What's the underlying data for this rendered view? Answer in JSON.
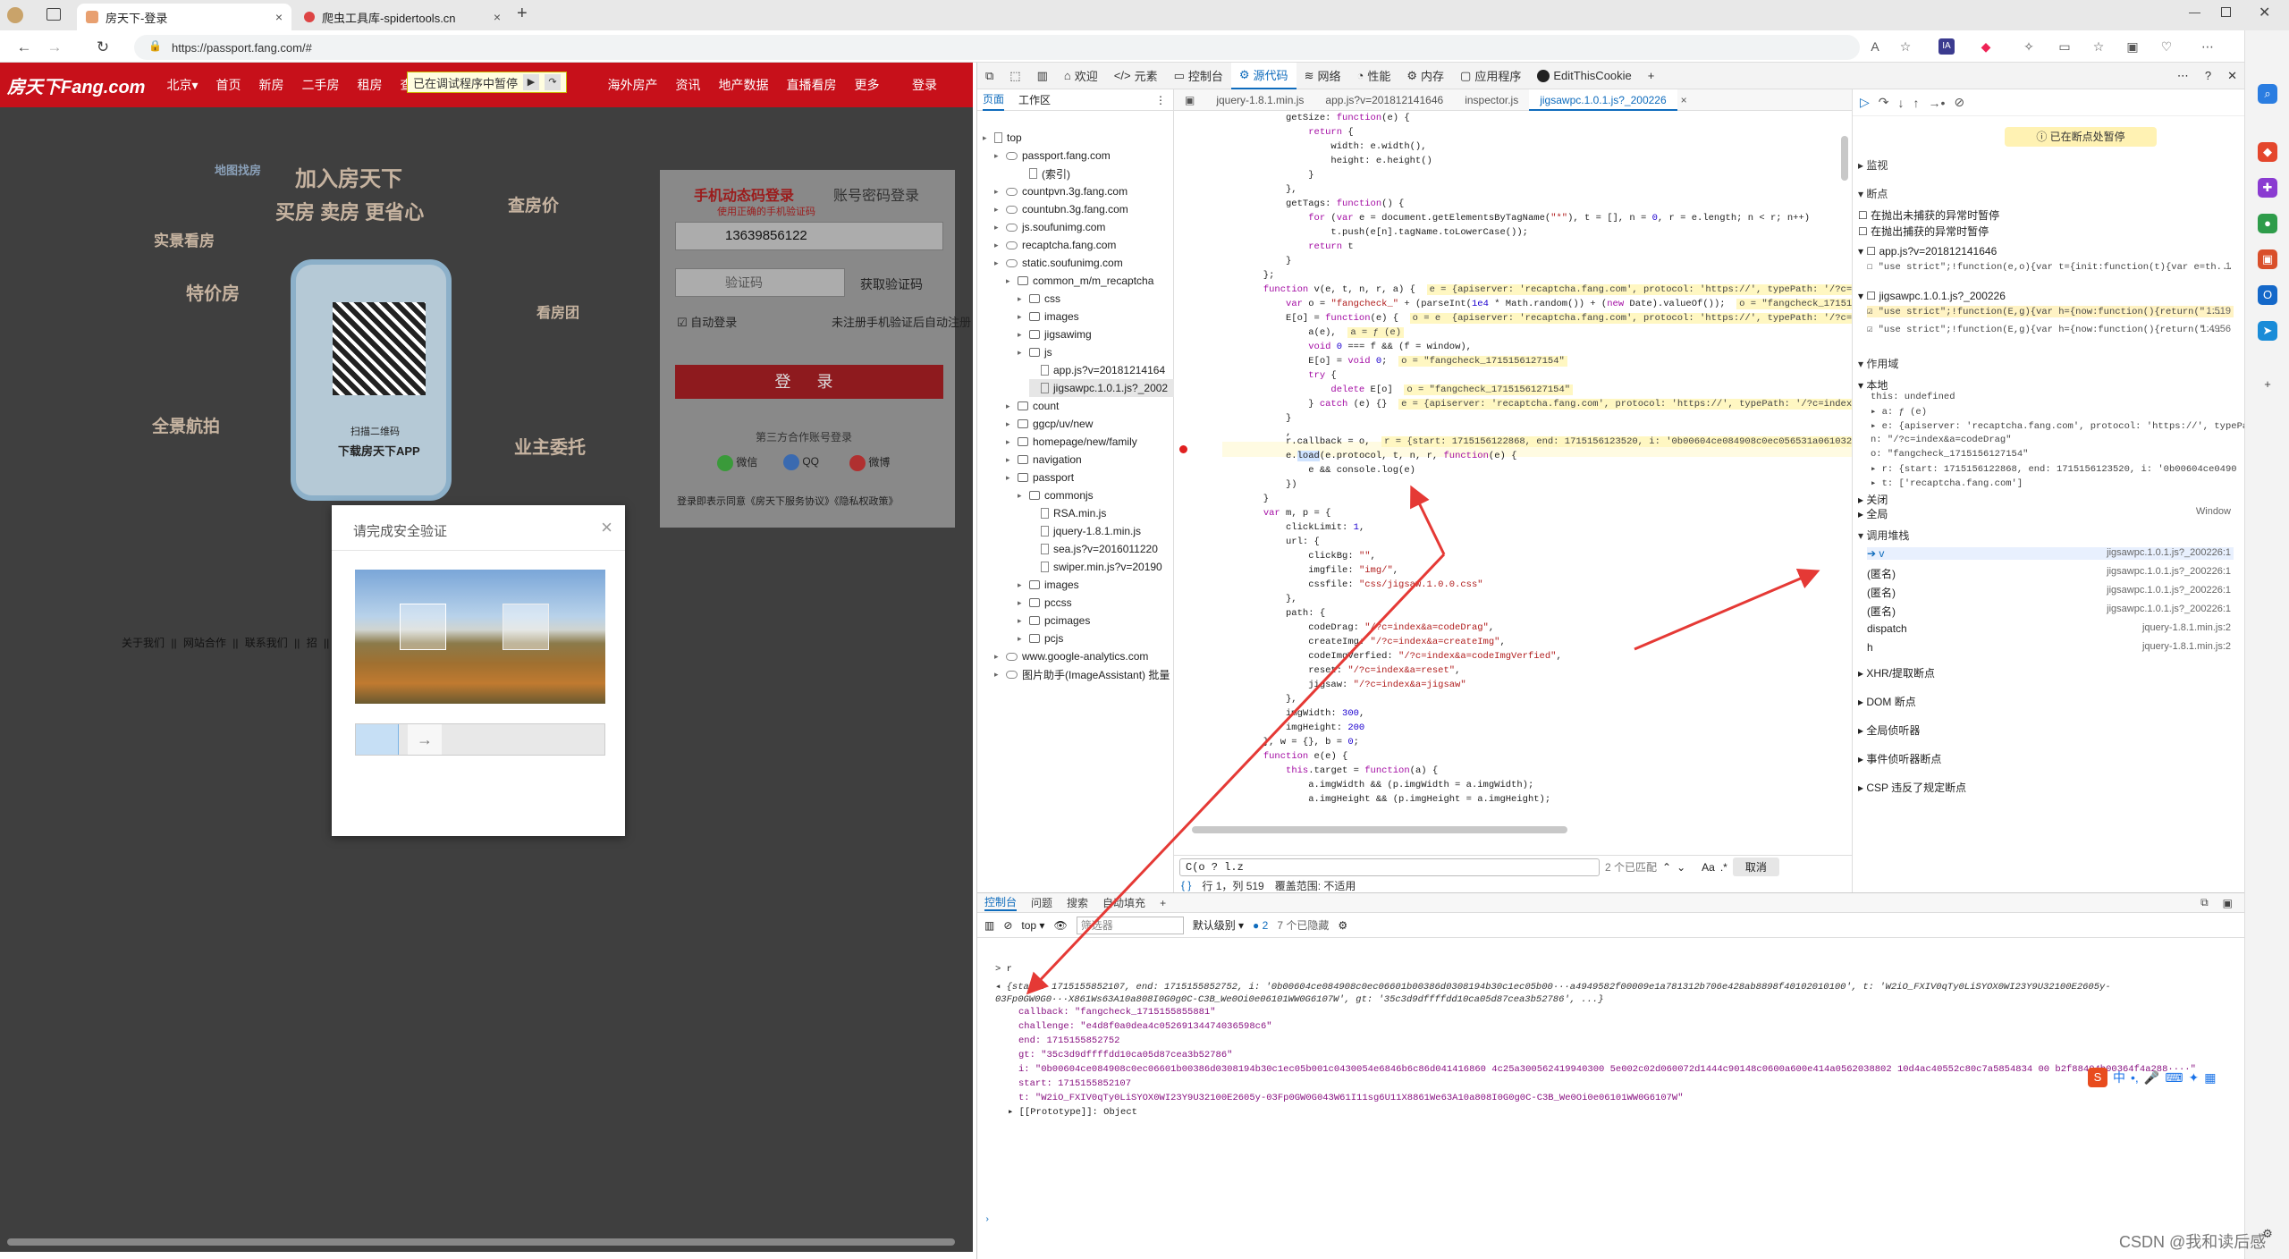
{
  "browser": {
    "tabs": [
      {
        "title": "房天下-登录",
        "active": true
      },
      {
        "title": "爬虫工具库-spidertools.cn",
        "active": false
      }
    ],
    "url": "https://passport.fang.com/#"
  },
  "page": {
    "nav": {
      "logo": "房天下Fang.com",
      "city": "北京▾",
      "items": [
        "首页",
        "新房",
        "二手房",
        "租房",
        "查房价"
      ],
      "items2": [
        "海外房产",
        "资讯",
        "地产数据",
        "直播看房",
        "更多"
      ],
      "login": "登录"
    },
    "paused_banner": "已在调试程序中暂停",
    "promo": {
      "title": "加入房天下",
      "sub": "买房 卖房 更省心",
      "tags": [
        "地图找房",
        "实景看房",
        "特价房",
        "全景航拍",
        "查房价",
        "看房团",
        "业主委托"
      ],
      "qr_caption": "扫描二维码",
      "qr_download": "下载房天下APP"
    },
    "login": {
      "tab_sms": "手机动态码登录",
      "tab_pwd": "账号密码登录",
      "notice": "使用正确的手机验证码",
      "phone": "13639856122",
      "code_placeholder": "验证码",
      "get_code": "获取验证码",
      "auto_login": "自动登录",
      "no_account": "未注册手机验证后自动注册",
      "submit": "登 录",
      "third": "第三方合作账号登录",
      "wechat": "微信",
      "qq": "QQ",
      "weibo": "微博",
      "agree": "登录即表示同意《房天下服务协议》《隐私权政策》"
    },
    "footer": "关于我们 || 网站合作 || 联系我们 || 招 || 开放平台 || 服务声明 || 加盟房天下",
    "captcha": {
      "title": "请完成安全验证",
      "close": "×"
    }
  },
  "devtools": {
    "tabs": [
      "欢迎",
      "元素",
      "控制台",
      "源代码",
      "网络",
      "性能",
      "内存",
      "应用程序",
      "EditThisCookie"
    ],
    "active_tab": "源代码",
    "nav_tabs": [
      "页面",
      "工作区"
    ],
    "tree": [
      {
        "label": "top",
        "indent": 0
      },
      {
        "label": "passport.fang.com",
        "indent": 1
      },
      {
        "label": "(索引)",
        "indent": 3
      },
      {
        "label": "countpvn.3g.fang.com",
        "indent": 1
      },
      {
        "label": "countubn.3g.fang.com",
        "indent": 1
      },
      {
        "label": "js.soufunimg.com",
        "indent": 1
      },
      {
        "label": "recaptcha.fang.com",
        "indent": 1
      },
      {
        "label": "static.soufunimg.com",
        "indent": 1
      },
      {
        "label": "common_m/m_recaptcha",
        "indent": 2
      },
      {
        "label": "css",
        "indent": 3
      },
      {
        "label": "images",
        "indent": 3
      },
      {
        "label": "jigsawimg",
        "indent": 3
      },
      {
        "label": "js",
        "indent": 3
      },
      {
        "label": "app.js?v=20181214164",
        "indent": 4
      },
      {
        "label": "jigsawpc.1.0.1.js?_2002",
        "indent": 4,
        "sel": true
      },
      {
        "label": "count",
        "indent": 2
      },
      {
        "label": "ggcp/uv/new",
        "indent": 2
      },
      {
        "label": "homepage/new/family",
        "indent": 2
      },
      {
        "label": "navigation",
        "indent": 2
      },
      {
        "label": "passport",
        "indent": 2
      },
      {
        "label": "commonjs",
        "indent": 3
      },
      {
        "label": "RSA.min.js",
        "indent": 4
      },
      {
        "label": "jquery-1.8.1.min.js",
        "indent": 4
      },
      {
        "label": "sea.js?v=2016011220",
        "indent": 4
      },
      {
        "label": "swiper.min.js?v=20190",
        "indent": 4
      },
      {
        "label": "images",
        "indent": 3
      },
      {
        "label": "pccss",
        "indent": 3
      },
      {
        "label": "pcimages",
        "indent": 3
      },
      {
        "label": "pcjs",
        "indent": 3
      },
      {
        "label": "www.google-analytics.com",
        "indent": 1
      },
      {
        "label": "图片助手(ImageAssistant) 批量",
        "indent": 1
      }
    ],
    "editor_tabs": [
      "jquery-1.8.1.min.js",
      "app.js?v=201812141646",
      "inspector.js",
      "jigsawpc.1.0.1.js?_200226"
    ],
    "search": {
      "value": "C(o ? l.z",
      "count": "2 个已匹配",
      "cancel": "取消",
      "aa": "Aa"
    },
    "status": {
      "pos": "行 1，列 519",
      "coverage": "覆盖范围: 不适用"
    },
    "right": {
      "paused": "已在断点处暂停",
      "watch": "监视",
      "breakpoints": "断点",
      "pause_uncaught": "在抛出未捕获的异常时暂停",
      "pause_caught": "在抛出捕获的异常时暂停",
      "bp_files": [
        {
          "file": "app.js?v=201812141646",
          "line": "\"use strict\";!function(e,o){var t={init:function(t){var e=th...",
          "n": "1"
        },
        {
          "file": "jigsawpc.1.0.1.js?_200226",
          "line": "\"use strict\";!function(E,g){var h={now:function(){return(\"...",
          "n": "1:519"
        },
        {
          "file": "",
          "line": "\"use strict\";!function(E,g){var h={now:function(){return(\"...",
          "n": "1:4956"
        }
      ],
      "scope": "作用域",
      "local": "本地",
      "scope_lines": [
        "this: undefined",
        "▸ a: ƒ (e)",
        "▸ e: {apiserver: 'recaptcha.fang.com', protocol: 'https://', typePat",
        "  n: \"/?c=index&a=codeDrag\"",
        "  o: \"fangcheck_1715156127154\"",
        "▸ r: {start: 1715156122868, end: 1715156123520, i: '0b00604ce0490",
        "▸ t: ['recaptcha.fang.com']"
      ],
      "closure": "关闭",
      "global": "全局",
      "global_val": "Window",
      "callstack": "调用堆栈",
      "frames": [
        {
          "name": "v",
          "src": "jigsawpc.1.0.1.js?_200226:1"
        },
        {
          "name": "(匿名)",
          "src": "jigsawpc.1.0.1.js?_200226:1"
        },
        {
          "name": "(匿名)",
          "src": "jigsawpc.1.0.1.js?_200226:1"
        },
        {
          "name": "(匿名)",
          "src": "jigsawpc.1.0.1.js?_200226:1"
        },
        {
          "name": "dispatch",
          "src": "jquery-1.8.1.min.js:2"
        },
        {
          "name": "h",
          "src": "jquery-1.8.1.min.js:2"
        }
      ],
      "more": [
        "XHR/提取断点",
        "DOM 断点",
        "全局侦听器",
        "事件侦听器断点",
        "CSP 违反了规定断点"
      ]
    },
    "drawer": {
      "tabs": [
        "控制台",
        "问题",
        "搜索",
        "自动填充"
      ],
      "context": "top",
      "filter": "筛选器",
      "level": "默认级别 ▾",
      "issues": "2",
      "hidden": "7 个已隐藏",
      "lines": [
        "> r",
        "◂ {start: 1715155852107, end: 1715155852752, i: '0b00604ce084908c0ec06601b00386d0308194b30c1ec05b00···a4949582f00009e1a781312b706e428ab8898f40102010100', t: 'W2iO_FXIV0qTy0LiSYOX0WI23Y9U32100E2605y-03Fp0GW0G0···X861Ws63A10a808I0G0g0C-C3B_We0Oi0e06101WW0G6107W', gt: '35c3d9dffffdd10ca05d87cea3b52786', ...}",
        "callback: \"fangcheck_1715155855881\"",
        "challenge: \"e4d8f0a0dea4c05269134474036598c6\"",
        "end: 1715155852752",
        "gt: \"35c3d9dffffdd10ca05d87cea3b52786\"",
        "i: \"0b00604ce084908c0ec06601b00386d0308194b30c1ec05b001c0430054e6846b6c86d041416860 4c25a300562419940300 5e002c02d060072d1444c90148c0600a600e414a0562038802 10d4ac40552c80c7a5854834 00 b2f88404b00364f4a288····\"",
        "start: 1715155852107",
        "t: \"W2iO_FXIV0qTy0LiSYOX0WI23Y9U32100E2605y-03Fp0GW0G043W61I11sg6U11X8861We63A10a808I0G0g0C-C3B_We0Oi0e06101WW0G6107W\"",
        "▸ [[Prototype]]: Object"
      ]
    }
  },
  "watermark": "CSDN @我和读后感"
}
